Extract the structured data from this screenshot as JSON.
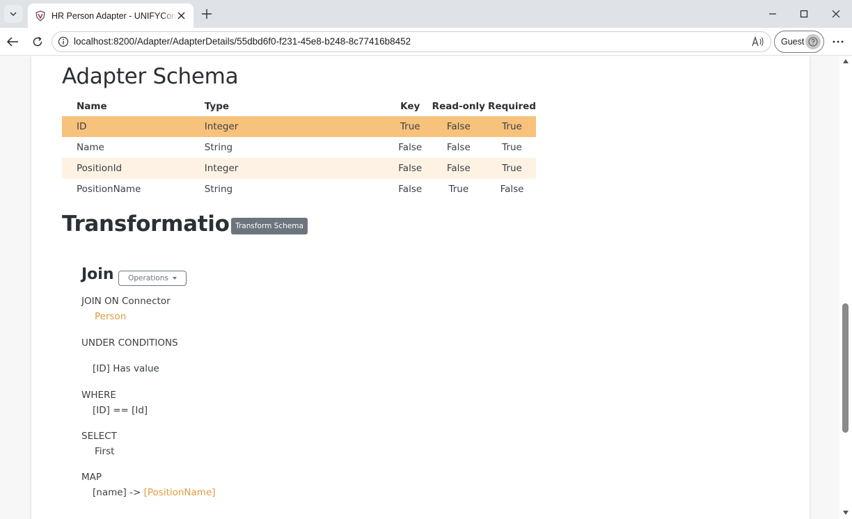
{
  "browser": {
    "tab_title": "HR Person Adapter - UNIFYConnect",
    "url": "localhost:8200/Adapter/AdapterDetails/55dbd6f0-f231-45e8-b248-8c77416b8452",
    "profile_label": "Guest"
  },
  "schema": {
    "title": "Adapter Schema",
    "columns": [
      "Name",
      "Type",
      "Key",
      "Read-only",
      "Required"
    ],
    "rows": [
      {
        "name": "ID",
        "type": "Integer",
        "key": "True",
        "read_only": "False",
        "required": "True"
      },
      {
        "name": "Name",
        "type": "String",
        "key": "False",
        "read_only": "False",
        "required": "True"
      },
      {
        "name": "PositionId",
        "type": "Integer",
        "key": "False",
        "read_only": "False",
        "required": "True"
      },
      {
        "name": "PositionName",
        "type": "String",
        "key": "False",
        "read_only": "True",
        "required": "False"
      }
    ]
  },
  "transformations": {
    "title": "Transformations",
    "transform_button": "Transform Schema",
    "join": {
      "title": "Join",
      "operations_button": "Operations",
      "join_on_label": "JOIN ON Connector",
      "connector": "Person",
      "under_conditions_label": "UNDER CONDITIONS",
      "condition": "[ID] Has value",
      "where_label": "WHERE",
      "where_expr": "[ID] == [Id]",
      "select_label": "SELECT",
      "select_value": "First",
      "map_label": "MAP",
      "map_source": "[name] ->",
      "map_target": "[PositionName]"
    }
  },
  "colors": {
    "selected_row": "#f7c27b",
    "alt_row": "#fdf2e4",
    "accent": "#e39a3d",
    "secondary_button": "#6c757d"
  }
}
